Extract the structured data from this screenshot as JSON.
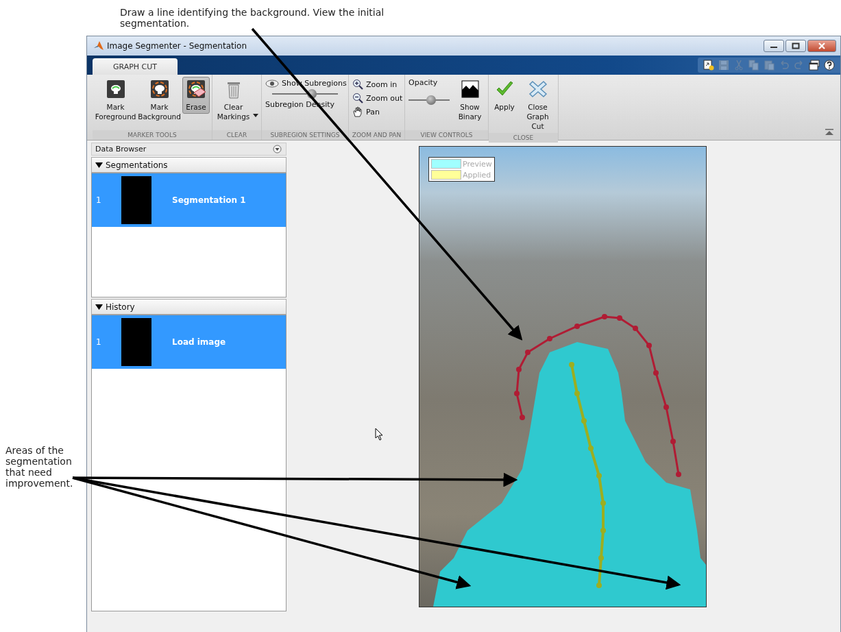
{
  "annotations": [
    {
      "text": "Draw a line identifying the background. View the initial segmentation."
    },
    {
      "text": "Areas of the segmentation that need improvement."
    }
  ],
  "window": {
    "title": "Image Segmenter - Segmentation"
  },
  "tabs": [
    {
      "label": "GRAPH CUT",
      "selected": true
    }
  ],
  "quick_access_toolbar": [
    {
      "disabled": false
    },
    {
      "disabled": true
    },
    {
      "disabled": true
    },
    {
      "disabled": true
    },
    {
      "disabled": true
    },
    {
      "disabled": true
    },
    {
      "disabled": true
    },
    {
      "disabled": false
    },
    {
      "disabled": false
    }
  ],
  "toolstrip": {
    "groups": [
      {
        "label": "MARKER TOOLS",
        "controls": [
          {
            "kind": "large",
            "label": "Mark Foreground",
            "selected": false
          },
          {
            "kind": "large",
            "label": "Mark Background",
            "selected": false
          },
          {
            "kind": "large",
            "label": "Erase",
            "selected": true
          }
        ]
      },
      {
        "label": "CLEAR",
        "controls": [
          {
            "kind": "dropdown",
            "label": "Clear Markings"
          }
        ]
      },
      {
        "label": "SUBREGION SETTINGS",
        "controls": [
          {
            "kind": "toggle",
            "label": "Show Subregions"
          },
          {
            "kind": "slider",
            "level": 0.6
          },
          {
            "kind": "caption",
            "label": "Subregion Density"
          }
        ]
      },
      {
        "label": "ZOOM AND PAN",
        "controls": [
          {
            "kind": "small",
            "label": "Zoom in"
          },
          {
            "kind": "small",
            "label": "Zoom out"
          },
          {
            "kind": "small",
            "label": "Pan"
          }
        ]
      },
      {
        "label": "VIEW CONTROLS",
        "controls": [
          {
            "kind": "labeled-slider",
            "label": "Opacity",
            "level": 0.55
          },
          {
            "kind": "large",
            "label": "Show Binary"
          }
        ]
      },
      {
        "label": "CLOSE",
        "controls": [
          {
            "kind": "large",
            "label": "Apply"
          },
          {
            "kind": "large",
            "label": "Close Graph Cut"
          }
        ]
      }
    ]
  },
  "data_browser": {
    "title": "Data Browser",
    "sections": [
      {
        "title": "Segmentations",
        "expanded": true,
        "items": [
          {
            "index": "1",
            "label": "Segmentation 1",
            "selected": true
          }
        ]
      },
      {
        "title": "History",
        "expanded": true,
        "items": [
          {
            "index": "1",
            "label": "Load image",
            "selected": true
          }
        ]
      }
    ]
  },
  "legend": [
    {
      "label": "Preview",
      "color": "#a0ffff"
    },
    {
      "label": "Applied",
      "color": "#ffff99"
    }
  ]
}
